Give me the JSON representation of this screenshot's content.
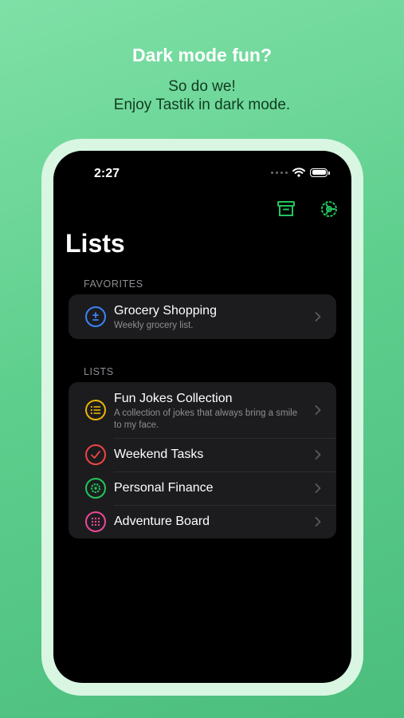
{
  "promo": {
    "headline": "Dark mode fun?",
    "subline_1": "So do we!",
    "subline_2": "Enjoy Tastik in dark mode."
  },
  "status_bar": {
    "time": "2:27"
  },
  "nav": {
    "icons": [
      "archive-icon",
      "gear-icon"
    ]
  },
  "page": {
    "title": "Lists"
  },
  "favorites": {
    "header": "FAVORITES",
    "items": [
      {
        "title": "Grocery Shopping",
        "subtitle": "Weekly grocery list.",
        "icon": "plus-minus-icon",
        "color": "#3b82f6"
      }
    ]
  },
  "lists": {
    "header": "LISTS",
    "items": [
      {
        "title": "Fun Jokes Collection",
        "subtitle": "A collection of jokes that always bring a smile to my face.",
        "icon": "list-icon",
        "color": "#eab308"
      },
      {
        "title": "Weekend Tasks",
        "icon": "checkmark-icon",
        "color": "#ef4444"
      },
      {
        "title": "Personal Finance",
        "icon": "gear-icon",
        "color": "#22c55e"
      },
      {
        "title": "Adventure Board",
        "icon": "grid-icon",
        "color": "#ec4899"
      }
    ]
  },
  "colors": {
    "accent": "#22c55e",
    "background": "#000000",
    "cell": "#1c1c1e"
  }
}
